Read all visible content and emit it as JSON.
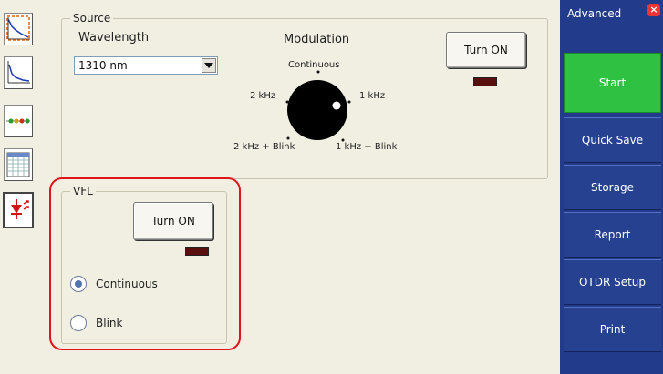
{
  "toolbar": {
    "items": [
      {
        "icon": "trace-overview-icon"
      },
      {
        "icon": "trace-zoom-icon"
      },
      {
        "icon": "event-line-icon"
      },
      {
        "icon": "event-table-icon"
      },
      {
        "icon": "laser-source-icon"
      }
    ]
  },
  "source": {
    "title": "Source",
    "wavelength_label": "Wavelength",
    "wavelength_value": "1310 nm",
    "modulation_label": "Modulation",
    "knob_positions": {
      "top": "Continuous",
      "left": "2 kHz",
      "right": "1 kHz",
      "bottom_left": "2 kHz + Blink",
      "bottom_right": "1 kHz + Blink"
    },
    "turn_on_label": "Turn ON"
  },
  "vfl": {
    "title": "VFL",
    "turn_on_label": "Turn ON",
    "options": [
      "Continuous",
      "Blink"
    ],
    "selected": "Continuous"
  },
  "right_panel": {
    "title": "Advanced",
    "buttons": [
      "Start",
      "Quick Save",
      "Storage",
      "Report",
      "OTDR Setup",
      "Print"
    ]
  }
}
